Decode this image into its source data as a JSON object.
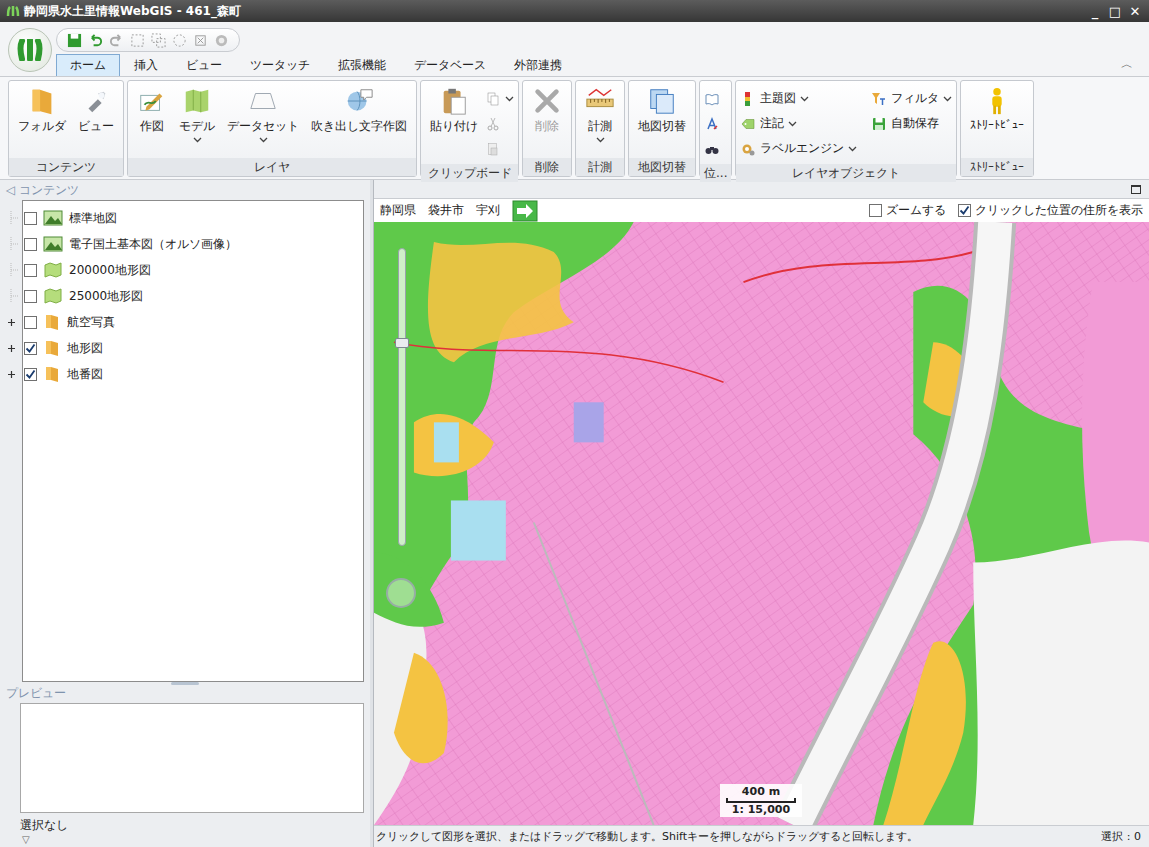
{
  "window": {
    "title": "静岡県水土里情報WebGIS - 461_森町",
    "buttons": [
      "_",
      "□",
      "✕"
    ]
  },
  "tabs": [
    {
      "label": "ホーム",
      "selected": true
    },
    {
      "label": "挿入",
      "selected": false
    },
    {
      "label": "ビュー",
      "selected": false
    },
    {
      "label": "ツータッチ",
      "selected": false
    },
    {
      "label": "拡張機能",
      "selected": false
    },
    {
      "label": "データベース",
      "selected": false
    },
    {
      "label": "外部連携",
      "selected": false
    }
  ],
  "ribbon_collapse": "︿",
  "ribbon": [
    {
      "label": "コンテンツ",
      "buttons": [
        {
          "label": "フォルダ",
          "kind": "large",
          "dropdown": false,
          "disabled": false
        },
        {
          "label": "ビュー",
          "kind": "large",
          "dropdown": false,
          "disabled": false
        }
      ]
    },
    {
      "label": "レイヤ",
      "buttons": [
        {
          "label": "作図",
          "kind": "large",
          "dropdown": false,
          "disabled": false
        },
        {
          "label": "モデル",
          "kind": "large",
          "dropdown": true,
          "disabled": false
        },
        {
          "label": "データセット",
          "kind": "large",
          "dropdown": true,
          "disabled": false
        },
        {
          "label": "吹き出し文字作図",
          "kind": "large",
          "dropdown": false,
          "disabled": false
        }
      ]
    },
    {
      "label": "クリップボード",
      "buttons": [
        {
          "label": "貼り付け",
          "kind": "large",
          "dropdown": false,
          "disabled": false
        },
        {
          "kind": "icon",
          "dropdown": true,
          "disabled": false
        },
        {
          "kind": "icon",
          "dropdown": false,
          "disabled": true
        },
        {
          "kind": "icon",
          "dropdown": false,
          "disabled": true
        }
      ]
    },
    {
      "label": "削除",
      "buttons": [
        {
          "label": "削除",
          "kind": "large",
          "dropdown": false,
          "disabled": true
        }
      ]
    },
    {
      "label": "計測",
      "buttons": [
        {
          "label": "計測",
          "kind": "large",
          "dropdown": true,
          "disabled": false
        }
      ]
    },
    {
      "label": "地図切替",
      "buttons": [
        {
          "label": "地図切替",
          "kind": "large",
          "dropdown": false,
          "disabled": false
        }
      ]
    },
    {
      "label": "位...",
      "buttons": [
        {
          "kind": "icon",
          "dropdown": false,
          "disabled": false
        },
        {
          "kind": "icon",
          "dropdown": false,
          "disabled": false
        },
        {
          "kind": "icon",
          "dropdown": false,
          "disabled": false
        }
      ]
    },
    {
      "label": "レイヤオブジェクト",
      "buttons": [
        {
          "label": "主題図",
          "kind": "small",
          "dropdown": true,
          "disabled": false
        },
        {
          "label": "注記",
          "kind": "small",
          "dropdown": true,
          "disabled": false
        },
        {
          "label": "ラベルエンジン",
          "kind": "small",
          "dropdown": true,
          "disabled": false
        },
        {
          "label": "フィルタ",
          "kind": "small",
          "dropdown": true,
          "disabled": false
        },
        {
          "label": "自動保存",
          "kind": "small",
          "dropdown": false,
          "disabled": false
        }
      ]
    },
    {
      "label": "ｽﾄﾘｰﾄﾋﾞｭｰ",
      "buttons": [
        {
          "label": "ｽﾄﾘｰﾄﾋﾞｭｰ",
          "kind": "large",
          "dropdown": false,
          "disabled": false
        }
      ]
    }
  ],
  "contents_panel": {
    "collapse": "◁",
    "title": "コンテンツ",
    "items": [
      {
        "label": "標準地図",
        "kind": "basemap",
        "checked": false,
        "expandable": false
      },
      {
        "label": "電子国土基本図（オルソ画像）",
        "kind": "basemap",
        "checked": false,
        "expandable": false
      },
      {
        "label": "200000地形図",
        "kind": "layer",
        "checked": false,
        "expandable": false
      },
      {
        "label": "25000地形図",
        "kind": "layer",
        "checked": false,
        "expandable": false
      },
      {
        "label": "航空写真",
        "kind": "folder",
        "checked": false,
        "expandable": true
      },
      {
        "label": "地形図",
        "kind": "folder",
        "checked": true,
        "expandable": true
      },
      {
        "label": "地番図",
        "kind": "folder",
        "checked": true,
        "expandable": true
      }
    ]
  },
  "preview": {
    "title": "プレビュー",
    "selection": "選択なし",
    "expand": "▽"
  },
  "map_panel": {
    "breadcrumb": [
      "静岡県",
      "袋井市",
      "宇刈"
    ],
    "options": [
      {
        "label": "ズームする",
        "checked": false
      },
      {
        "label": "クリックした位置の住所を表示",
        "checked": true
      }
    ],
    "zoom": {
      "level": 0.69
    },
    "scale": {
      "distance": "400 m",
      "ratio": "1: 15,000"
    }
  },
  "status_bar": {
    "message": "クリックして図形を選択、またはドラッグで移動します。Shiftキーを押しながらドラッグすると回転します。",
    "selection": "選択 : 0"
  }
}
